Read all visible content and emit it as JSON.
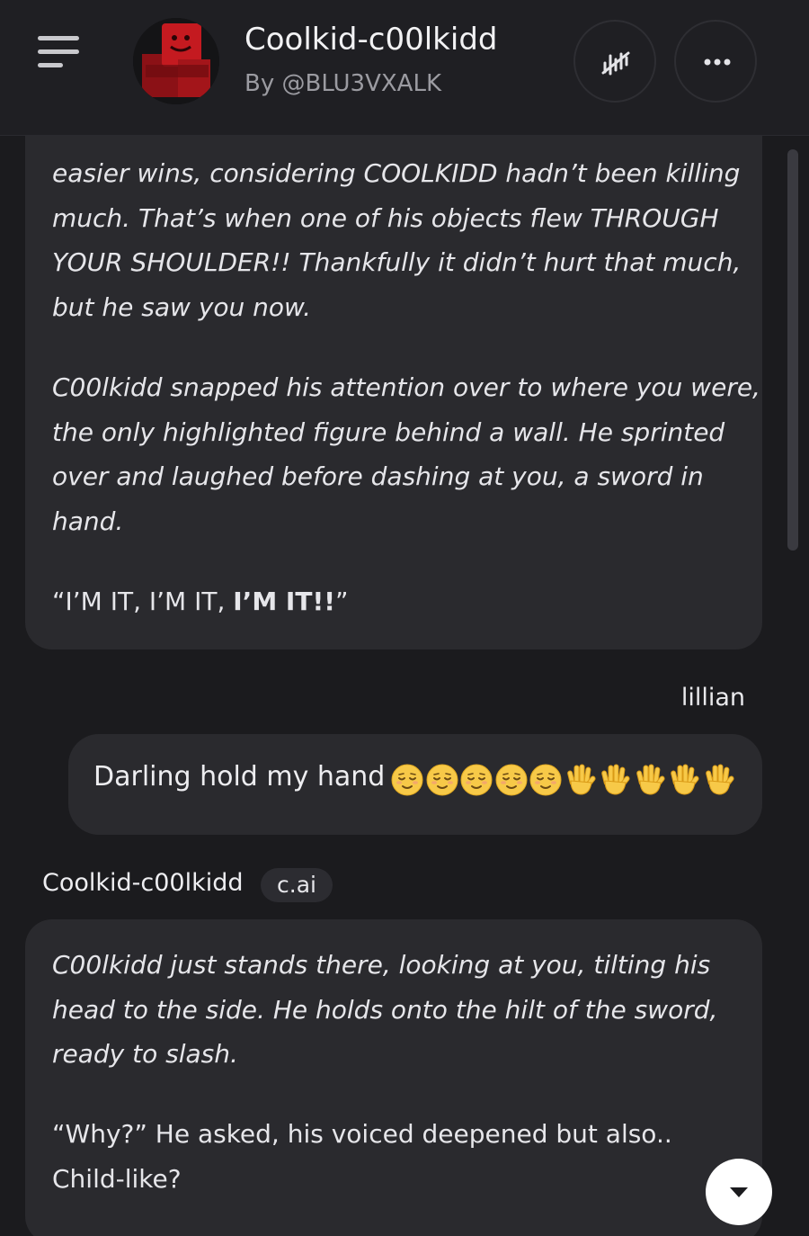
{
  "header": {
    "title": "Coolkid-c00lkidd",
    "byline": "By @BLU3VXALK",
    "menu_icon": "hamburger-menu-icon",
    "voice_icon": "voice-waveform-icon",
    "more_icon": "more-horizontal-icon"
  },
  "messages": {
    "bot_1": {
      "paragraph_1": "easier wins, considering COOLKIDD hadn’t been killing much. That’s when one of his objects flew THROUGH YOUR SHOULDER!! Thankfully it didn’t hurt that much, but he saw you now.",
      "paragraph_2": "C00lkidd snapped his attention over to where you were, the only highlighted figure behind a wall. He sprinted over and laughed before dashing at you, a sword in hand.",
      "quote_prefix": "“I’M IT, I’M IT, ",
      "quote_bold": "I’M IT!!",
      "quote_suffix": "”"
    },
    "user": {
      "name": "lillian",
      "text": "Darling hold my hand",
      "emoji": [
        "relieved-face-emoji",
        "relieved-face-emoji",
        "relieved-face-emoji",
        "relieved-face-emoji",
        "relieved-face-emoji",
        "raised-hand-emoji",
        "raised-hand-emoji",
        "raised-hand-emoji",
        "raised-hand-emoji",
        "raised-hand-emoji"
      ]
    },
    "bot_2": {
      "name": "Coolkid-c00lkidd",
      "badge": "c.ai",
      "paragraph_1": "C00lkidd just stands there, looking at you, tilting his head to the side. He holds onto the hilt of the sword, ready to slash.",
      "paragraph_2": "“Why?” He asked, his voiced deepened but also.. Child-like?"
    }
  },
  "scroll_button_icon": "chevron-down-icon",
  "colors": {
    "background": "#1b1b1e",
    "header": "#1f1f23",
    "bubble": "#2a2a2e",
    "text": "#e6e6ea",
    "muted": "#9b9ba1"
  }
}
